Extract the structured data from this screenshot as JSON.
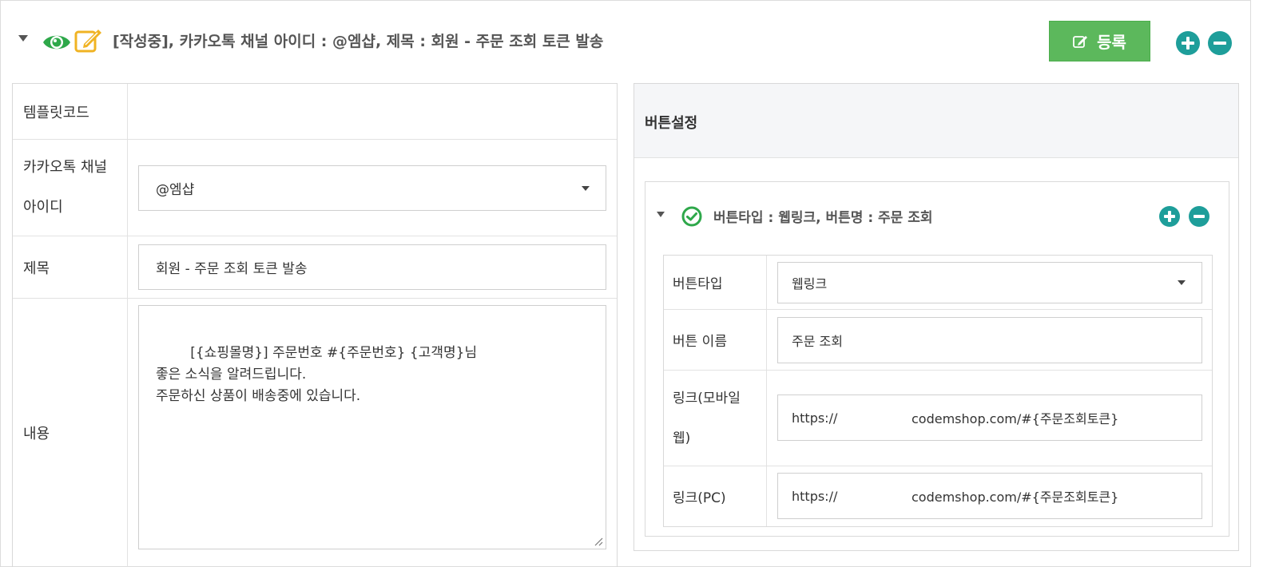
{
  "header": {
    "title": "[작성중], 카카오톡 채널 아이디 : @엠샵, 제목 : 회원 - 주문 조회 토큰 발송",
    "register_label": "등록",
    "icons": [
      "caret-down-icon",
      "eye-icon",
      "edit-icon",
      "plus-circle-icon",
      "minus-circle-icon"
    ]
  },
  "form": {
    "template_code_label": "템플릿코드",
    "template_code_value": "",
    "channel_label_line1": "카카오톡 채널",
    "channel_label_line2": "아이디",
    "channel_value": "@엠샵",
    "subject_label": "제목",
    "subject_value": "회원 - 주문 조회 토큰 발송",
    "content_label": "내용",
    "content_value": "[{쇼핑몰명}] 주문번호 #{주문번호} {고객명}님\n좋은 소식을 알려드립니다.\n주문하신 상품이 배송중에 있습니다."
  },
  "button_settings": {
    "title": "버튼설정",
    "item_title": "버튼타입 : 웹링크, 버튼명 : 주문 조회",
    "type_label": "버튼타입",
    "type_value": "웹링크",
    "name_label": "버튼 이름",
    "name_value": "주문 조회",
    "link_mobile_label_line1": "링크(모바일",
    "link_mobile_label_line2": "웹)",
    "link_mobile_scheme": "https://",
    "link_mobile_value": "codemshop.com/#{주문조회토큰}",
    "link_pc_label": "링크(PC)",
    "link_pc_scheme": "https://",
    "link_pc_value": "codemshop.com/#{주문조회토큰}"
  },
  "colors": {
    "accent_green": "#5cb85c",
    "teal": "#1e9e9a",
    "eye_green": "#2ea84a",
    "edit_yellow": "#f0b323"
  }
}
